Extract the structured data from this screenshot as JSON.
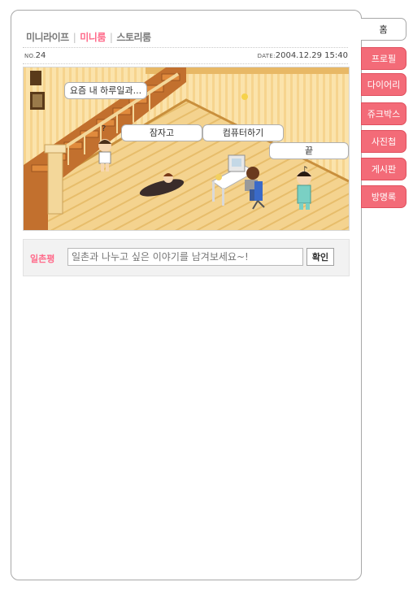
{
  "subnav": {
    "items": [
      "미니라이프",
      "미니룸",
      "스토리룸"
    ],
    "separator": "|"
  },
  "info": {
    "no_label": "NO.",
    "no_value": "24",
    "date_label": "DATE:",
    "date_value": "2004.12.29 15:40"
  },
  "room": {
    "bubbles": [
      "요즘 내 하루일과...",
      "잠자고",
      "컴퓨터하기",
      "끝"
    ]
  },
  "guestbook": {
    "label": "일촌평",
    "placeholder": "일촌과 나누고 싶은 이야기를 남겨보세요~!",
    "button": "확인"
  },
  "tabs": [
    "홈",
    "프로필",
    "다이어리",
    "쥬크박스",
    "사진첩",
    "게시판",
    "방명록"
  ],
  "colors": {
    "accent": "#ff6a8a",
    "tab": "#f36b78",
    "floor": "#f2cf86",
    "wall": "#fbe2a8"
  }
}
